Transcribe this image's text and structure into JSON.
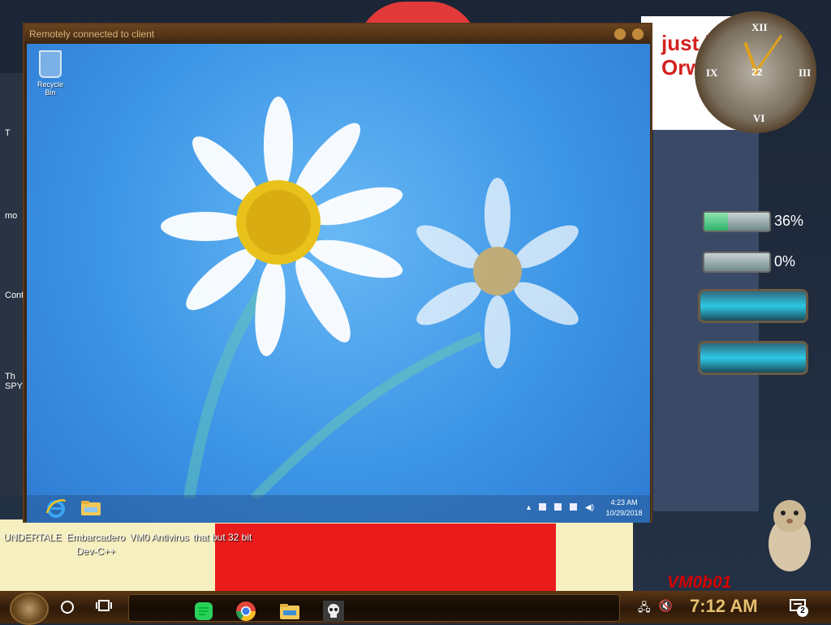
{
  "remote_window": {
    "title": "Remotely connected to client"
  },
  "remote_desktop": {
    "recycle_bin_label": "Recycle Bin",
    "taskbar": {
      "apps": [
        "internet-explorer-icon",
        "file-explorer-icon"
      ],
      "tray_icons": [
        "show-hidden-icons-arrow",
        "action-center-flag-icon",
        "battery-icon",
        "network-icon",
        "volume-icon"
      ],
      "clock_time": "4:23 AM",
      "clock_date": "10/29/2018"
    }
  },
  "host_desktop": {
    "banner_text": "just like Orwell",
    "clock_gadget_day": "22",
    "gauges": [
      {
        "label": "cpu-gauge",
        "value": "36%",
        "fill": 0.36
      },
      {
        "label": "ram-gauge",
        "value": "0%",
        "fill": 0.0
      }
    ],
    "desktop_icons": [
      {
        "label": "UNDERTALE"
      },
      {
        "label": "Embarcadero Dev-C++"
      },
      {
        "label": "VM0 Antivirus"
      },
      {
        "label": "that but 32 bit"
      }
    ],
    "left_partial_labels": [
      "T",
      "mo",
      "Cont",
      "Th SPY"
    ],
    "watermark": "VM0b01"
  },
  "host_taskbar": {
    "pinned": [
      "start-button",
      "cortana-search-button",
      "task-view-button"
    ],
    "apps": [
      "spotify-icon",
      "chrome-icon",
      "file-explorer-icon",
      "skull-app-icon"
    ],
    "tray": [
      "network-icon",
      "volume-muted-icon"
    ],
    "clock": "7:12 AM",
    "notification_count": "2"
  },
  "colors": {
    "remote_wallpaper": "#3c95e6",
    "host_taskbar": "#3e240c",
    "clock_text": "#e6c070"
  }
}
